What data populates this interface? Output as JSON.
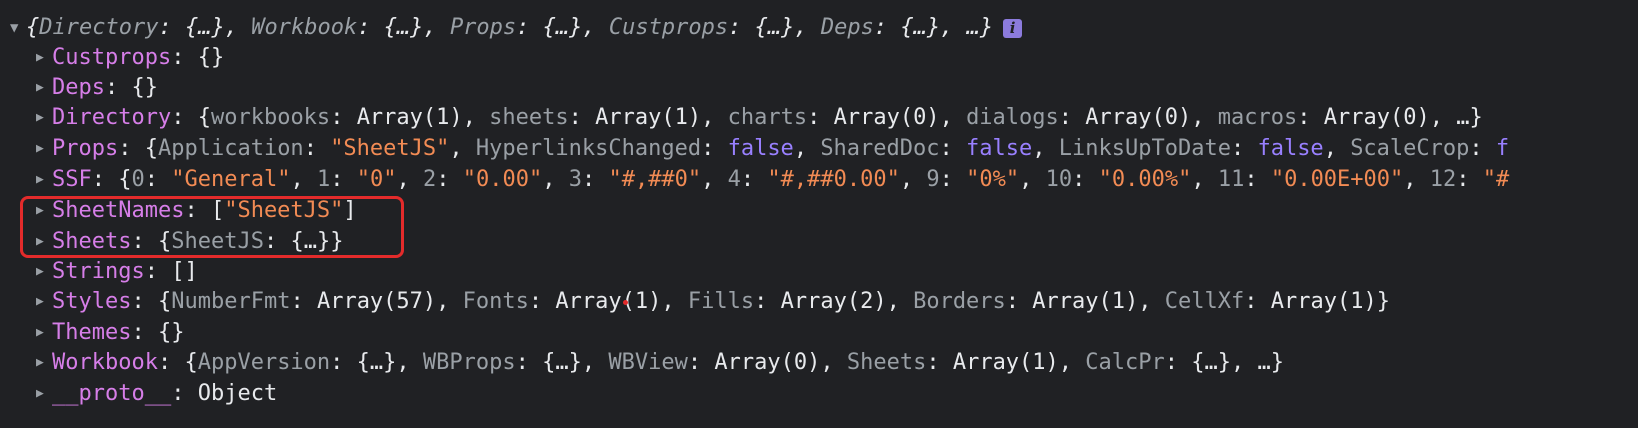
{
  "summary": {
    "prefix": "{",
    "parts": [
      {
        "k": "Directory",
        "v": "{…}"
      },
      {
        "k": "Workbook",
        "v": "{…}"
      },
      {
        "k": "Props",
        "v": "{…}"
      },
      {
        "k": "Custprops",
        "v": "{…}"
      },
      {
        "k": "Deps",
        "v": "{…}"
      }
    ],
    "suffix": ", …}",
    "info_glyph": "i"
  },
  "properties": {
    "custprops": {
      "key": "Custprops",
      "value": "{}"
    },
    "deps": {
      "key": "Deps",
      "value": "{}"
    },
    "directory": {
      "key": "Directory",
      "parts": [
        {
          "k": "workbooks",
          "v": "Array(1)"
        },
        {
          "k": "sheets",
          "v": "Array(1)"
        },
        {
          "k": "charts",
          "v": "Array(0)"
        },
        {
          "k": "dialogs",
          "v": "Array(0)"
        },
        {
          "k": "macros",
          "v": "Array(0)"
        }
      ],
      "suffix": ", …}"
    },
    "props": {
      "key": "Props",
      "parts": [
        {
          "k": "Application",
          "v": "\"SheetJS\"",
          "t": "str"
        },
        {
          "k": "HyperlinksChanged",
          "v": "false",
          "t": "bool"
        },
        {
          "k": "SharedDoc",
          "v": "false",
          "t": "bool"
        },
        {
          "k": "LinksUpToDate",
          "v": "false",
          "t": "bool"
        },
        {
          "k": "ScaleCrop",
          "v": "f",
          "t": "bool"
        }
      ]
    },
    "ssf": {
      "key": "SSF",
      "parts": [
        {
          "k": "0",
          "v": "\"General\""
        },
        {
          "k": "1",
          "v": "\"0\""
        },
        {
          "k": "2",
          "v": "\"0.00\""
        },
        {
          "k": "3",
          "v": "\"#,##0\""
        },
        {
          "k": "4",
          "v": "\"#,##0.00\""
        },
        {
          "k": "9",
          "v": "\"0%\""
        },
        {
          "k": "10",
          "v": "\"0.00%\""
        },
        {
          "k": "11",
          "v": "\"0.00E+00\""
        },
        {
          "k": "12",
          "v": "\"#"
        }
      ]
    },
    "sheetnames": {
      "key": "SheetNames",
      "open": "[",
      "item": "\"SheetJS\"",
      "close": "]"
    },
    "sheets": {
      "key": "Sheets",
      "inner_key": "SheetJS",
      "inner_val": "{…}"
    },
    "strings": {
      "key": "Strings",
      "value": "[]"
    },
    "styles": {
      "key": "Styles",
      "parts": [
        {
          "k": "NumberFmt",
          "v": "Array(57)"
        },
        {
          "k": "Fonts",
          "v": "Array(1)"
        },
        {
          "k": "Fills",
          "v": "Array(2)"
        },
        {
          "k": "Borders",
          "v": "Array(1)"
        },
        {
          "k": "CellXf",
          "v": "Array(1)"
        }
      ],
      "suffix": "}"
    },
    "themes": {
      "key": "Themes",
      "value": "{}"
    },
    "workbook": {
      "key": "Workbook",
      "parts": [
        {
          "k": "AppVersion",
          "v": "{…}"
        },
        {
          "k": "WBProps",
          "v": "{…}"
        },
        {
          "k": "WBView",
          "v": "Array(0)"
        },
        {
          "k": "Sheets",
          "v": "Array(1)"
        },
        {
          "k": "CalcPr",
          "v": "{…}"
        }
      ],
      "suffix": ", …}"
    },
    "proto": {
      "key": "__proto__",
      "value": "Object"
    }
  },
  "colors": {
    "background": "#202124",
    "key": "#d67ee8",
    "string": "#f28b54",
    "boolean": "#9980ff",
    "highlight": "#e32b2b"
  },
  "icons": {
    "collapsed": "triangle-right-icon",
    "expanded": "triangle-down-icon",
    "info": "info-icon"
  }
}
